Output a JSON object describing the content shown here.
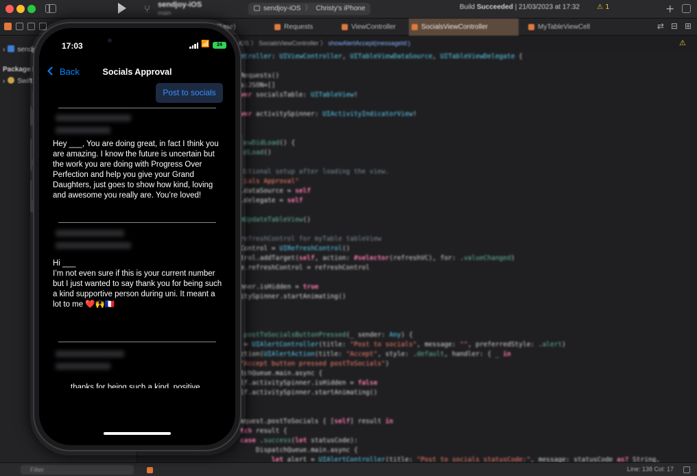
{
  "xcode": {
    "project_name": "sendjoy-iOS",
    "branch": "main",
    "scheme": "sendjoy-iOS",
    "device": "Christy's iPhone",
    "build_status_prefix": "Build ",
    "build_status_result": "Succeeded",
    "build_status_time": " | 21/03/2023 at 17:32",
    "warning_count": "1",
    "tabs": [
      {
        "label": "(Base)"
      },
      {
        "label": "Requests"
      },
      {
        "label": "ViewController"
      },
      {
        "label": "SocialsViewController"
      },
      {
        "label": "MyTableViewCell"
      }
    ],
    "sidebar": {
      "project_item": "sendjoy-iOS",
      "packages_header": "Package Dependencies",
      "package_item": "Swift Package"
    },
    "breadcrumb": {
      "path": "iOS 〉 SocialsViewController 〉",
      "function": "showAlertAccept(messageId:)"
    },
    "code_lines": [
      {
        "tokens": [
          [
            "t",
            "ntroller"
          ],
          [
            "",
            ": "
          ],
          [
            "t",
            "UIViewController"
          ],
          [
            "",
            ", "
          ],
          [
            "t",
            "UITableViewDataSource"
          ],
          [
            "",
            ", "
          ],
          [
            "t",
            "UITableViewDelegate"
          ],
          [
            "",
            " {"
          ]
        ]
      },
      {
        "tokens": [
          [
            "",
            ""
          ]
        ]
      },
      {
        "tokens": [
          [
            "",
            "Requests()"
          ]
        ]
      },
      {
        "tokens": [
          [
            "",
            "s:JSON=[]"
          ]
        ]
      },
      {
        "tokens": [
          [
            "k",
            "ver "
          ],
          [
            "",
            "socialsTable"
          ],
          [
            "",
            ": "
          ],
          [
            "t",
            "UITableView"
          ],
          [
            "",
            "!"
          ]
        ]
      },
      {
        "tokens": [
          [
            "",
            ""
          ]
        ]
      },
      {
        "tokens": [
          [
            "k",
            "ver "
          ],
          [
            "",
            "activitySpinner"
          ],
          [
            "",
            ": "
          ],
          [
            "t",
            "UIActivityIndicatorView"
          ],
          [
            "",
            "!"
          ]
        ]
      },
      {
        "tokens": [
          [
            "",
            ""
          ]
        ]
      },
      {
        "tokens": [
          [
            "",
            ""
          ]
        ]
      },
      {
        "tokens": [
          [
            "f",
            "iewDidLoad"
          ],
          [
            "",
            "() {"
          ]
        ]
      },
      {
        "tokens": [
          [
            "f",
            "idLoad"
          ],
          [
            "",
            "()"
          ]
        ]
      },
      {
        "tokens": [
          [
            "",
            ""
          ]
        ]
      },
      {
        "tokens": [
          [
            "c",
            "ditional setup after loading the view."
          ]
        ]
      },
      {
        "tokens": [
          [
            "s",
            "cials Approval\""
          ]
        ]
      },
      {
        "tokens": [
          [
            "",
            ".dataSource = "
          ],
          [
            "k",
            "self"
          ]
        ]
      },
      {
        "tokens": [
          [
            "",
            ".delegate = "
          ],
          [
            "k",
            "self"
          ]
        ]
      },
      {
        "tokens": [
          [
            "",
            ""
          ]
        ]
      },
      {
        "tokens": [
          [
            "f",
            "nUpdateTableView"
          ],
          [
            "",
            "()"
          ]
        ]
      },
      {
        "tokens": [
          [
            "",
            ""
          ]
        ]
      },
      {
        "tokens": [
          [
            "c",
            "refreshControl for myTable tableView"
          ]
        ]
      },
      {
        "tokens": [
          [
            "",
            "Control = "
          ],
          [
            "t",
            "UIRefreshControl"
          ],
          [
            "",
            "()"
          ]
        ]
      },
      {
        "tokens": [
          [
            "",
            "trol.addTarget("
          ],
          [
            "k",
            "self"
          ],
          [
            "",
            ", action: "
          ],
          [
            "k",
            "#selector"
          ],
          [
            "",
            "(refreshVC), "
          ],
          [
            "",
            "for: "
          ],
          [
            "",
            "."
          ],
          [
            "f",
            "valueChanged"
          ],
          [
            "",
            ")"
          ]
        ]
      },
      {
        "tokens": [
          [
            "",
            "e.refreshControl = refreshControl"
          ]
        ]
      },
      {
        "tokens": [
          [
            "",
            ""
          ]
        ]
      },
      {
        "tokens": [
          [
            "",
            "nner.isHidden = "
          ],
          [
            "k",
            "true"
          ]
        ]
      },
      {
        "tokens": [
          [
            "",
            "itySpinner.startAnimating()"
          ]
        ]
      },
      {
        "tokens": [
          [
            "",
            ""
          ]
        ]
      },
      {
        "tokens": [
          [
            "",
            ""
          ]
        ]
      },
      {
        "tokens": [
          [
            "",
            ""
          ]
        ]
      },
      {
        "tokens": [
          [
            "f",
            " postToSocialsButtonPressed"
          ],
          [
            "",
            "(_ sender: "
          ],
          [
            "t",
            "Any"
          ],
          [
            "",
            ") {"
          ]
        ]
      },
      {
        "tokens": [
          [
            "",
            "",
            " = "
          ],
          [
            "t",
            "UIAlertController"
          ],
          [
            "",
            "(title: "
          ],
          [
            "s",
            "\"Post to socials\""
          ],
          [
            "",
            ", message: "
          ],
          [
            "s",
            "\"\""
          ],
          [
            "",
            ", preferredStyle: ."
          ],
          [
            "f",
            "alert"
          ],
          [
            "",
            ")"
          ]
        ]
      },
      {
        "tokens": [
          [
            "",
            "ction("
          ],
          [
            "t",
            "UIAlertAction"
          ],
          [
            "",
            "(title: "
          ],
          [
            "s",
            "\"Accept\""
          ],
          [
            "",
            ", style: ."
          ],
          [
            "f",
            "default"
          ],
          [
            "",
            ", handler: { _ "
          ],
          [
            "k",
            "in"
          ]
        ]
      },
      {
        "tokens": [
          [
            "s",
            "\"Accept button pressed postToSocials\""
          ],
          [
            "",
            ")"
          ]
        ]
      },
      {
        "tokens": [
          [
            "",
            "tchQueue.main.async {"
          ]
        ]
      },
      {
        "tokens": [
          [
            "",
            "lf.activitySpinner.isHidden = "
          ],
          [
            "k",
            "false"
          ]
        ]
      },
      {
        "tokens": [
          [
            "",
            "lf.activitySpinner.startAnimating()"
          ]
        ]
      },
      {
        "tokens": [
          [
            "",
            ""
          ]
        ]
      },
      {
        "tokens": [
          [
            "",
            ""
          ]
        ]
      },
      {
        "tokens": [
          [
            "",
            "equest.postToSocials { ["
          ],
          [
            "k",
            "self"
          ],
          [
            "",
            "] result "
          ],
          [
            "k",
            "in"
          ]
        ]
      },
      {
        "tokens": [
          [
            "k",
            "tch "
          ],
          [
            "",
            "result {"
          ]
        ]
      },
      {
        "tokens": [
          [
            "k",
            "case "
          ],
          [
            "",
            "."
          ],
          [
            "f",
            "success"
          ],
          [
            "",
            "("
          ],
          [
            "k",
            "let "
          ],
          [
            "",
            "statusCode):"
          ]
        ]
      },
      {
        "tokens": [
          [
            "",
            "    DispatchQueue.main.async {"
          ]
        ]
      },
      {
        "tokens": [
          [
            "",
            "        "
          ],
          [
            "k",
            "let "
          ],
          [
            "",
            "alert = "
          ],
          [
            "t",
            "UIAlertController"
          ],
          [
            "",
            "(title: "
          ],
          [
            "s",
            "\"Post to socials statusCode:\""
          ],
          [
            "",
            ", message: statusCode "
          ],
          [
            "k",
            "as?"
          ],
          [
            "",
            " String,"
          ]
        ]
      }
    ],
    "status": {
      "filter_placeholder": "Filter",
      "cursor_position": "Line: 138  Col: 17"
    }
  },
  "phone": {
    "status_time": "17:03",
    "battery_level": "24",
    "back_label": "Back",
    "nav_title": "Socials Approval",
    "post_button": "Post to socials",
    "messages": [
      {
        "body": "Hey ___, You are doing great, in fact I think you are amazing. I know the future is uncertain but the work you are doing with Progress Over Perfection and help you give your Grand Daughters, just goes to show how kind, loving and awesome you really are. You’re loved!"
      },
      {
        "body": "Hi ___\nI’m not even sure if this is your current number but I just wanted to say thank you for being such a kind supportive person during uni. It meant a lot to me ❤️🙌🇫🇷"
      }
    ],
    "partial_message": "thanks for being such a kind, positive"
  },
  "colors": {
    "accent": "#0a84ff",
    "post_button_bg": "#1c2b42",
    "battery": "#30d158",
    "active_tab": "#5c4a3d"
  }
}
